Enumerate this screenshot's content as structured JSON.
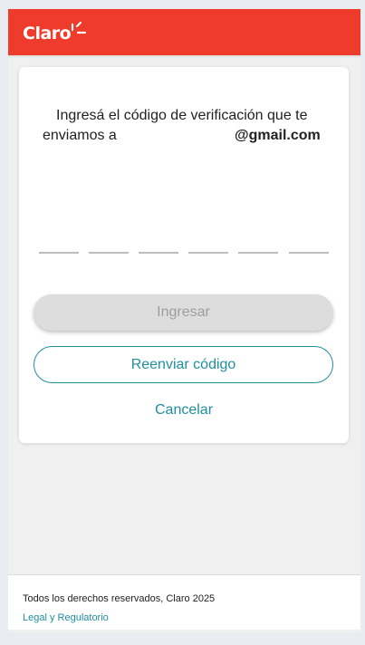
{
  "header": {
    "brand": "Claro",
    "logo_icon": "claro-rays-icon",
    "color": "#ee3b2b"
  },
  "verification": {
    "message_line1": "Ingresá el código de verificación que te",
    "message_line2_prefix": "enviamos a",
    "email_suffix": "@gmail.com",
    "code_digits": [
      "",
      "",
      "",
      "",
      "",
      ""
    ]
  },
  "actions": {
    "submit_label": "Ingresar",
    "resend_label": "Reenviar código",
    "cancel_label": "Cancelar",
    "accent_color": "#1f8fa0"
  },
  "footer": {
    "copyright": "Todos los derechos reservados, Claro 2025",
    "legal_link": "Legal y Regulatorio"
  }
}
